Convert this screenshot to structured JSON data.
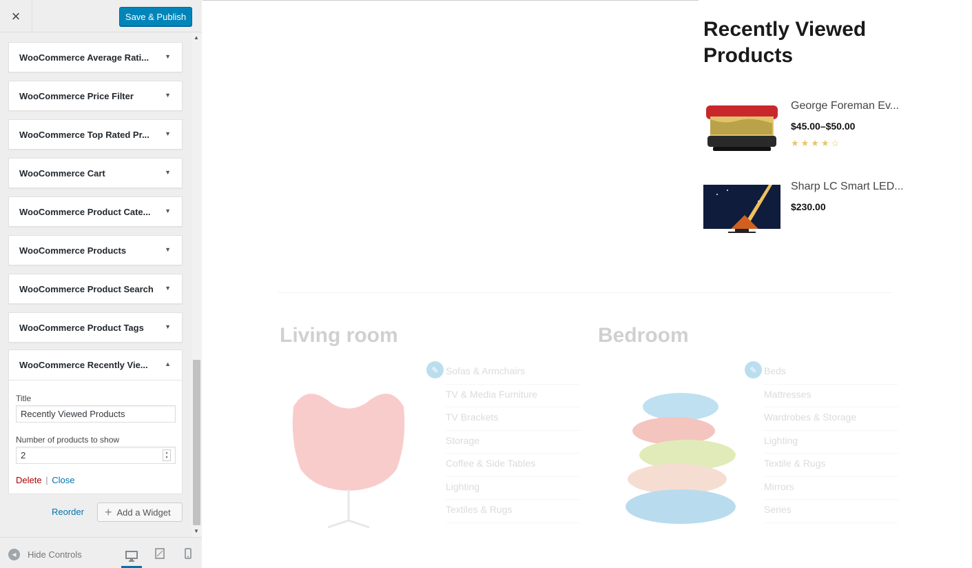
{
  "header": {
    "close_label": "×",
    "publish_label": "Save & Publish"
  },
  "widgets": [
    {
      "title": "WooCommerce Average Rati..."
    },
    {
      "title": "WooCommerce Price Filter"
    },
    {
      "title": "WooCommerce Top Rated Pr..."
    },
    {
      "title": "WooCommerce Cart"
    },
    {
      "title": "WooCommerce Product Cate..."
    },
    {
      "title": "WooCommerce Products"
    },
    {
      "title": "WooCommerce Product Search"
    },
    {
      "title": "WooCommerce Product Tags"
    }
  ],
  "open_widget": {
    "title": "WooCommerce Recently Vie...",
    "title_label": "Title",
    "title_value": "Recently Viewed Products",
    "count_label": "Number of products to show",
    "count_value": "2",
    "delete_label": "Delete",
    "separator": "|",
    "close_label": "Close"
  },
  "sidebar_actions": {
    "reorder_label": "Reorder",
    "add_widget_label": "Add a Widget"
  },
  "footer": {
    "hide_controls_label": "Hide Controls",
    "devices": [
      "desktop-icon",
      "tablet-icon",
      "mobile-icon"
    ]
  },
  "preview": {
    "recently_viewed_heading": "Recently Viewed Products",
    "products": [
      {
        "name": "George Foreman Ev...",
        "price": "$45.00–$50.00",
        "rating": 4
      },
      {
        "name": "Sharp LC Smart LED...",
        "price": "$230.00"
      }
    ],
    "categories": [
      {
        "title": "Living room",
        "links": [
          "Sofas & Armchairs",
          "TV & Media Furniture",
          "TV Brackets",
          "Storage",
          "Coffee & Side Tables",
          "Lighting",
          "Textiles & Rugs"
        ]
      },
      {
        "title": "Bedroom",
        "links": [
          "Beds",
          "Mattresses",
          "Wardrobes & Storage",
          "Lighting",
          "Textile & Rugs",
          "Mirrors",
          "Series"
        ]
      }
    ]
  },
  "colors": {
    "accent": "#0085ba",
    "link": "#0073aa",
    "delete": "#aa0000",
    "star": "#e8c46a"
  }
}
